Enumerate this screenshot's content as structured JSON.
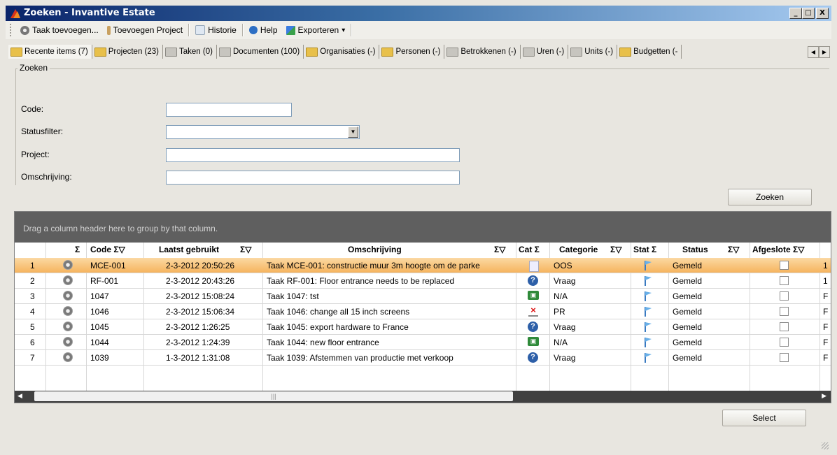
{
  "window": {
    "title": "Zoeken - Invantive Estate",
    "buttons": [
      "_",
      "□",
      "X"
    ]
  },
  "toolbar": {
    "items": [
      {
        "label": "Taak toevoegen...",
        "icon": "gear-icon"
      },
      {
        "label": "Toevoegen Project",
        "icon": "figure-icon"
      },
      {
        "label": "Historie",
        "icon": "history-icon"
      },
      {
        "label": "Help",
        "icon": "help-icon"
      },
      {
        "label": "Exporteren",
        "icon": "export-icon",
        "caret": "▾"
      }
    ]
  },
  "tabs": [
    {
      "label": "Recente items (7)"
    },
    {
      "label": "Projecten (23)"
    },
    {
      "label": "Taken (0)"
    },
    {
      "label": "Documenten (100)"
    },
    {
      "label": "Organisaties (-)"
    },
    {
      "label": "Personen (-)"
    },
    {
      "label": "Betrokkenen (-)"
    },
    {
      "label": "Uren (-)"
    },
    {
      "label": "Units (-)"
    },
    {
      "label": "Budgetten (-"
    }
  ],
  "search": {
    "group_title": "Zoeken",
    "fields": {
      "code_label": "Code:",
      "status_label": "Statusfilter:",
      "project_label": "Project:",
      "omschrijving_label": "Omschrijving:",
      "code_value": "",
      "project_value": "",
      "omschrijving_value": ""
    },
    "button": "Zoeken"
  },
  "grid": {
    "group_hint": "Drag a column header here to group by that column.",
    "headers": {
      "sigma1": "Σ",
      "code": "Code Σ▽",
      "laatst": "Laatst gebruikt",
      "laatst_icons": "Σ▽",
      "omschrijving": "Omschrijving",
      "om_icons": "Σ▽",
      "cat": "Cat Σ",
      "categorie": "Categorie",
      "categorie_icons": "Σ▽",
      "stat": "Stat Σ",
      "status": "Status",
      "status_icons": "Σ▽",
      "afgesloten": "Afgeslote Σ▽"
    },
    "rows": [
      {
        "n": "1",
        "code": "MCE-001",
        "date": "2-3-2012 20:50:26",
        "omschrijving": "Taak MCE-001: constructie muur 3m hoogte om de parke",
        "cat_icon": "document-icon",
        "categorie": "OOS",
        "status": "Gemeld",
        "extra": "1",
        "selected": true
      },
      {
        "n": "2",
        "code": "RF-001",
        "date": "2-3-2012 20:43:26",
        "omschrijving": "Taak RF-001: Floor entrance needs to be replaced",
        "cat_icon": "question-icon",
        "categorie": "Vraag",
        "status": "Gemeld",
        "extra": "1"
      },
      {
        "n": "3",
        "code": "1047",
        "date": "2-3-2012 15:08:24",
        "omschrijving": "Taak 1047: tst",
        "cat_icon": "picture-icon",
        "categorie": "N/A",
        "status": "Gemeld",
        "extra": "F"
      },
      {
        "n": "4",
        "code": "1046",
        "date": "2-3-2012 15:06:34",
        "omschrijving": "Taak 1046: change all 15 inch screens",
        "cat_icon": "cross-icon",
        "categorie": "PR",
        "status": "Gemeld",
        "extra": "F"
      },
      {
        "n": "5",
        "code": "1045",
        "date": "2-3-2012 1:26:25",
        "omschrijving": "Taak 1045: export hardware to France",
        "cat_icon": "question-icon",
        "categorie": "Vraag",
        "status": "Gemeld",
        "extra": "F"
      },
      {
        "n": "6",
        "code": "1044",
        "date": "2-3-2012 1:24:39",
        "omschrijving": "Taak 1044: new floor entrance",
        "cat_icon": "picture-icon",
        "categorie": "N/A",
        "status": "Gemeld",
        "extra": "F"
      },
      {
        "n": "7",
        "code": "1039",
        "date": "1-3-2012 1:31:08",
        "omschrijving": "Taak 1039: Afstemmen van productie met verkoop",
        "cat_icon": "question-icon",
        "categorie": "Vraag",
        "status": "Gemeld",
        "extra": "F"
      }
    ]
  },
  "select_button": "Select",
  "colors": {
    "selected_row": "#f6b45e",
    "group_panel": "#5f5f5f",
    "title_bar": "#0a246a"
  }
}
